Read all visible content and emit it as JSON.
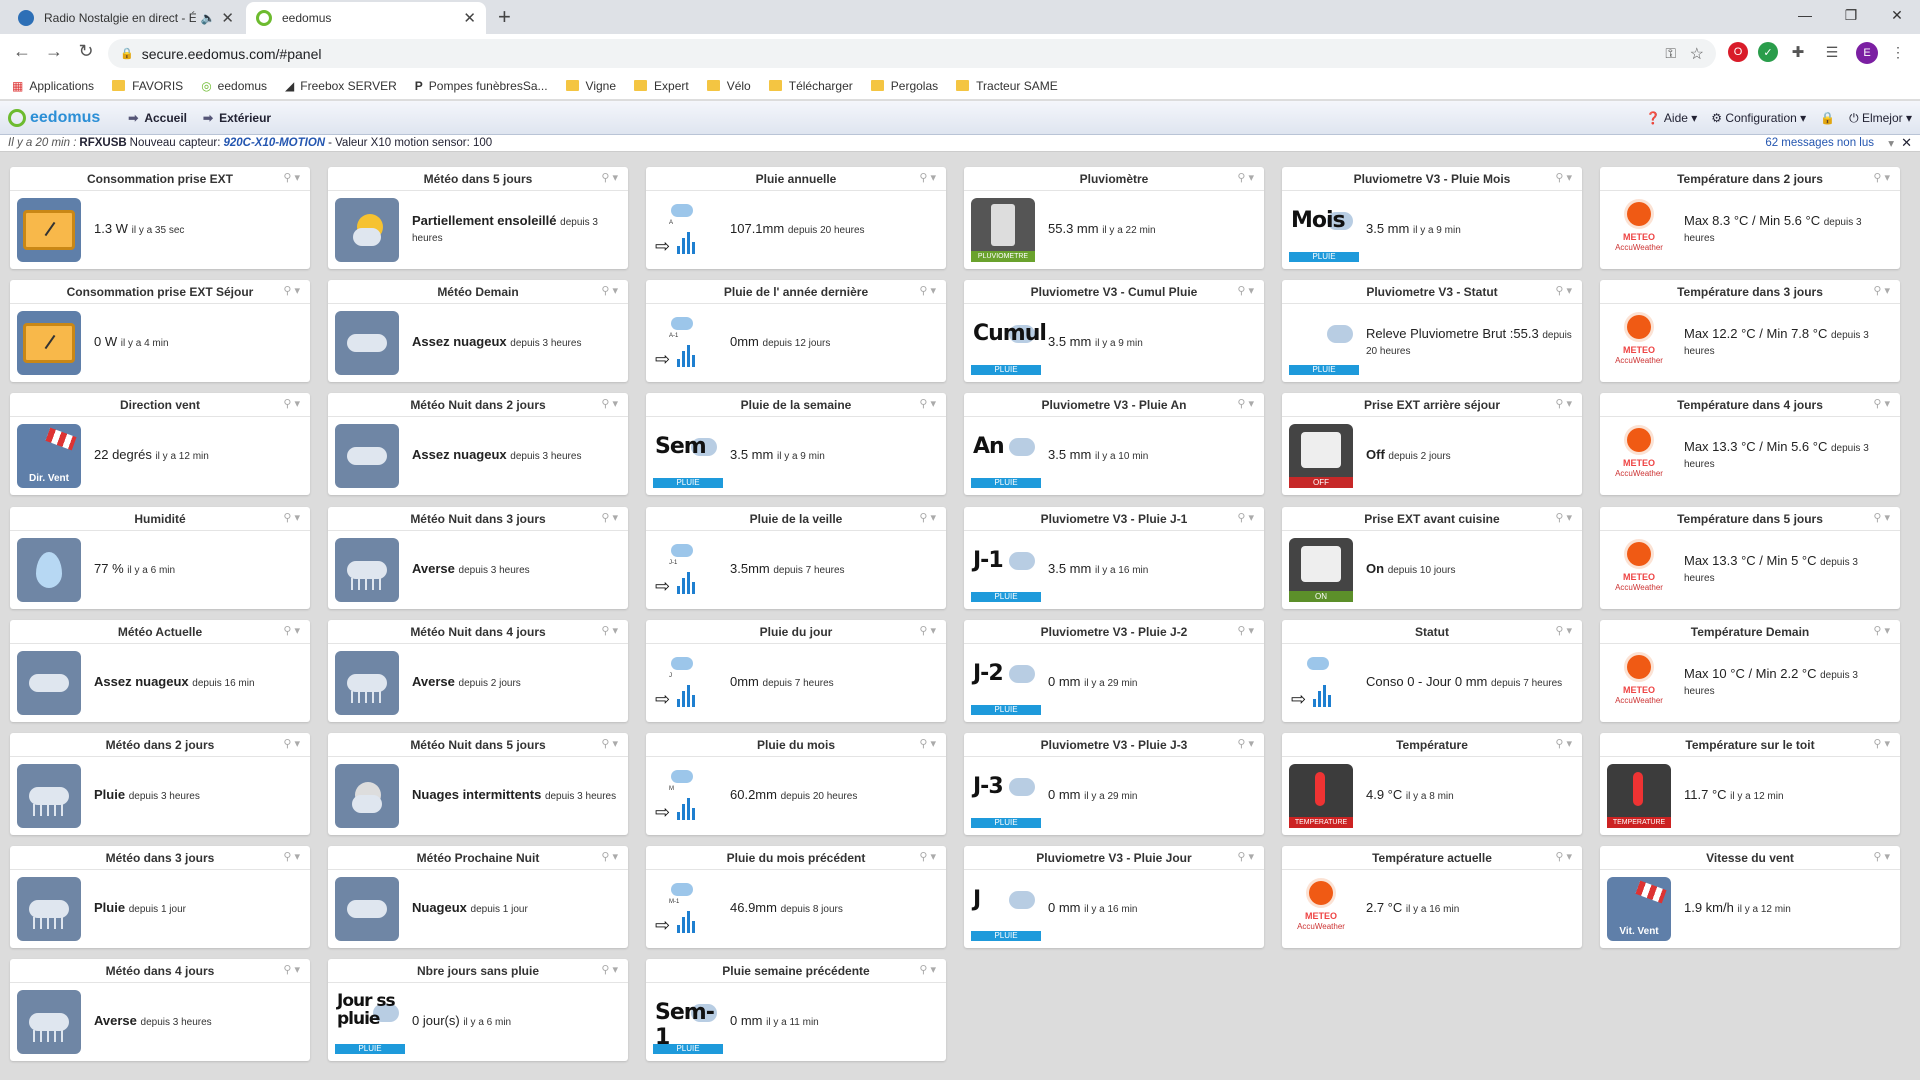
{
  "browser": {
    "tabs": [
      {
        "title": "Radio Nostalgie en direct - É",
        "favicon_color": "#2d6fb6"
      },
      {
        "title": "eedomus",
        "favicon_color": "#6dbb2f"
      }
    ],
    "new_tab": "+",
    "url": "secure.eedomus.com/#panel",
    "profile_initial": "E",
    "bookmarks": [
      "Applications",
      "FAVORIS",
      "eedomus",
      "Freebox SERVER",
      "Pompes funèbresSa...",
      "Vigne",
      "Expert",
      "Vélo",
      "Télécharger",
      "Pergolas",
      "Tracteur SAME"
    ]
  },
  "app": {
    "logo": "eedomus",
    "nav": [
      "Accueil",
      "Extérieur"
    ],
    "right": {
      "help": "Aide",
      "config": "Configuration",
      "user": "Elmejor"
    },
    "message": {
      "time": "Il y a 20 min :",
      "source": "RFXUSB",
      "text1": "Nouveau capteur:",
      "device": "920C-X10-MOTION",
      "text2": "- Valeur X10 motion sensor: 100",
      "unread": "62 messages non lus"
    }
  },
  "cards": [
    {
      "col": 0,
      "row": 0,
      "title": "Consommation prise EXT",
      "icon": "gauge",
      "value": "1.3 W",
      "sub": "il y a 35 sec"
    },
    {
      "col": 0,
      "row": 1,
      "title": "Consommation prise EXT Séjour",
      "icon": "gauge",
      "value": "0 W",
      "sub": "il y a 4 min"
    },
    {
      "col": 0,
      "row": 2,
      "title": "Direction vent",
      "icon": "sock",
      "label": "Dir. Vent",
      "value": "22 degrés",
      "sub": "il y a 12 min"
    },
    {
      "col": 0,
      "row": 3,
      "title": "Humidité",
      "icon": "drop",
      "value": "77 %",
      "sub": "il y a 6 min"
    },
    {
      "col": 0,
      "row": 4,
      "title": "Météo Actuelle",
      "icon": "cloud",
      "value": "Assez nuageux",
      "bold": true,
      "sub": "depuis 16 min"
    },
    {
      "col": 0,
      "row": 5,
      "title": "Météo dans 2 jours",
      "icon": "rain",
      "value": "Pluie",
      "bold": true,
      "sub": "depuis 3 heures"
    },
    {
      "col": 0,
      "row": 6,
      "title": "Météo dans 3 jours",
      "icon": "rain",
      "value": "Pluie",
      "bold": true,
      "sub": "depuis 1 jour"
    },
    {
      "col": 0,
      "row": 7,
      "title": "Météo dans 4 jours",
      "icon": "rain",
      "value": "Averse",
      "bold": true,
      "sub": "depuis 3 heures"
    },
    {
      "col": 1,
      "row": 0,
      "title": "Météo dans 5 jours",
      "icon": "sun",
      "value": "Partiellement ensoleillé",
      "bold": true,
      "sub": "depuis 3 heures"
    },
    {
      "col": 1,
      "row": 1,
      "title": "Météo Demain",
      "icon": "cloud",
      "value": "Assez nuageux",
      "bold": true,
      "sub": "depuis 3 heures"
    },
    {
      "col": 1,
      "row": 2,
      "title": "Météo Nuit dans 2 jours",
      "icon": "cloud",
      "value": "Assez nuageux",
      "bold": true,
      "sub": "depuis 3 heures"
    },
    {
      "col": 1,
      "row": 3,
      "title": "Météo Nuit dans 3 jours",
      "icon": "rain",
      "value": "Averse",
      "bold": true,
      "sub": "depuis 3 heures"
    },
    {
      "col": 1,
      "row": 4,
      "title": "Météo Nuit dans 4 jours",
      "icon": "rain",
      "value": "Averse",
      "bold": true,
      "sub": "depuis 2 jours"
    },
    {
      "col": 1,
      "row": 5,
      "title": "Météo Nuit dans 5 jours",
      "icon": "moon",
      "value": "Nuages intermittents",
      "bold": true,
      "sub": "depuis 3 heures"
    },
    {
      "col": 1,
      "row": 6,
      "title": "Météo Prochaine Nuit",
      "icon": "cloud",
      "value": "Nuageux",
      "bold": true,
      "sub": "depuis 1 jour"
    },
    {
      "col": 1,
      "row": 7,
      "title": "Nbre jours sans pluie",
      "icon": "text",
      "word": "Jour ss pluie",
      "band": "PLUIE",
      "value": "0 jour(s)",
      "sub": "il y a 6 min"
    },
    {
      "col": 2,
      "row": 0,
      "title": "Pluie annuelle",
      "icon": "smallrain",
      "tag": "A",
      "value": "107.1mm",
      "sub": "depuis 20 heures"
    },
    {
      "col": 2,
      "row": 1,
      "title": "Pluie de l' année dernière",
      "icon": "smallrain",
      "tag": "A-1",
      "value": "0mm",
      "sub": "depuis 12 jours"
    },
    {
      "col": 2,
      "row": 2,
      "title": "Pluie de la semaine",
      "icon": "text",
      "word": "Sem",
      "band": "PLUIE",
      "value": "3.5 mm",
      "sub": "il y a 9 min"
    },
    {
      "col": 2,
      "row": 3,
      "title": "Pluie de la veille",
      "icon": "smallrain",
      "tag": "J-1",
      "value": "3.5mm",
      "sub": "depuis 7 heures"
    },
    {
      "col": 2,
      "row": 4,
      "title": "Pluie du jour",
      "icon": "smallrain",
      "tag": "J",
      "value": "0mm",
      "sub": "depuis 7 heures"
    },
    {
      "col": 2,
      "row": 5,
      "title": "Pluie du mois",
      "icon": "smallrain",
      "tag": "M",
      "value": "60.2mm",
      "sub": "depuis 20 heures"
    },
    {
      "col": 2,
      "row": 6,
      "title": "Pluie du mois précédent",
      "icon": "smallrain",
      "tag": "M-1",
      "value": "46.9mm",
      "sub": "depuis 8 jours"
    },
    {
      "col": 2,
      "row": 7,
      "title": "Pluie semaine précédente",
      "icon": "text",
      "word": "Sem-1",
      "band": "PLUIE",
      "value": "0 mm",
      "sub": "il y a 11 min"
    },
    {
      "col": 3,
      "row": 0,
      "title": "Pluviomètre",
      "icon": "pluvio",
      "band": "PLUVIOMETRE",
      "value": "55.3 mm",
      "sub": "il y a 22 min"
    },
    {
      "col": 3,
      "row": 1,
      "title": "Pluviometre V3 - Cumul Pluie",
      "icon": "text",
      "word": "Cumul",
      "band": "PLUIE",
      "value": "3.5 mm",
      "sub": "il y a 9 min"
    },
    {
      "col": 3,
      "row": 2,
      "title": "Pluviometre V3 - Pluie An",
      "icon": "text",
      "word": "An",
      "band": "PLUIE",
      "value": "3.5 mm",
      "sub": "il y a 10 min"
    },
    {
      "col": 3,
      "row": 3,
      "title": "Pluviometre V3 - Pluie J-1",
      "icon": "text",
      "word": "J-1",
      "band": "PLUIE",
      "value": "3.5 mm",
      "sub": "il y a 16 min"
    },
    {
      "col": 3,
      "row": 4,
      "title": "Pluviometre V3 - Pluie J-2",
      "icon": "text",
      "word": "J-2",
      "band": "PLUIE",
      "value": "0 mm",
      "sub": "il y a 29 min"
    },
    {
      "col": 3,
      "row": 5,
      "title": "Pluviometre V3 - Pluie J-3",
      "icon": "text",
      "word": "J-3",
      "band": "PLUIE",
      "value": "0 mm",
      "sub": "il y a 29 min"
    },
    {
      "col": 3,
      "row": 6,
      "title": "Pluviometre V3 - Pluie Jour",
      "icon": "text",
      "word": "J",
      "band": "PLUIE",
      "value": "0 mm",
      "sub": "il y a 16 min"
    },
    {
      "col": 4,
      "row": 0,
      "title": "Pluviometre V3 - Pluie Mois",
      "icon": "text",
      "word": "Mois",
      "band": "PLUIE",
      "value": "3.5 mm",
      "sub": "il y a 9 min"
    },
    {
      "col": 4,
      "row": 1,
      "title": "Pluviometre V3 - Statut",
      "icon": "text",
      "word": "",
      "band": "PLUIE",
      "value": "Releve Pluviometre Brut :55.3",
      "sub": "depuis 20 heures"
    },
    {
      "col": 4,
      "row": 2,
      "title": "Prise EXT arrière séjour",
      "icon": "outlet",
      "band": "OFF",
      "band_color": "#c62828",
      "value": "Off",
      "bold": true,
      "sub": "depuis 2 jours"
    },
    {
      "col": 4,
      "row": 3,
      "title": "Prise EXT avant cuisine",
      "icon": "outlet",
      "band": "ON",
      "band_color": "#5c8f2a",
      "value": "On",
      "bold": true,
      "sub": "depuis 10 jours"
    },
    {
      "col": 4,
      "row": 4,
      "title": "Statut",
      "icon": "smallrain",
      "tag": "",
      "value": "Conso 0 - Jour 0 mm",
      "sub": "depuis 7 heures"
    },
    {
      "col": 4,
      "row": 5,
      "title": "Température",
      "icon": "thermo",
      "band": "TEMPERATURE",
      "value": "4.9 °C",
      "sub": "il y a 8 min"
    },
    {
      "col": 4,
      "row": 6,
      "title": "Température actuelle",
      "icon": "meteo",
      "value": "2.7 °C",
      "sub": "il y a 16 min"
    },
    {
      "col": 5,
      "row": 0,
      "title": "Température dans 2 jours",
      "icon": "meteo",
      "value": "Max 8.3 °C / Min 5.6 °C",
      "sub": "depuis 3 heures"
    },
    {
      "col": 5,
      "row": 1,
      "title": "Température dans 3 jours",
      "icon": "meteo",
      "value": "Max 12.2 °C / Min 7.8 °C",
      "sub": "depuis 3 heures"
    },
    {
      "col": 5,
      "row": 2,
      "title": "Température dans 4 jours",
      "icon": "meteo",
      "value": "Max 13.3 °C / Min 5.6 °C",
      "sub": "depuis 3 heures"
    },
    {
      "col": 5,
      "row": 3,
      "title": "Température dans 5 jours",
      "icon": "meteo",
      "value": "Max 13.3 °C / Min 5 °C",
      "sub": "depuis 3 heures"
    },
    {
      "col": 5,
      "row": 4,
      "title": "Température Demain",
      "icon": "meteo",
      "value": "Max 10 °C / Min 2.2 °C",
      "sub": "depuis 3 heures"
    },
    {
      "col": 5,
      "row": 5,
      "title": "Température sur le toit",
      "icon": "thermo",
      "band": "TEMPERATURE",
      "value": "11.7 °C",
      "sub": "il y a 12 min"
    },
    {
      "col": 5,
      "row": 6,
      "title": "Vitesse du vent",
      "icon": "sock",
      "label": "Vit. Vent",
      "value": "1.9 km/h",
      "sub": "il y a 12 min"
    }
  ],
  "meteo_text": {
    "line1": "METEO",
    "line2": "AccuWeather"
  }
}
